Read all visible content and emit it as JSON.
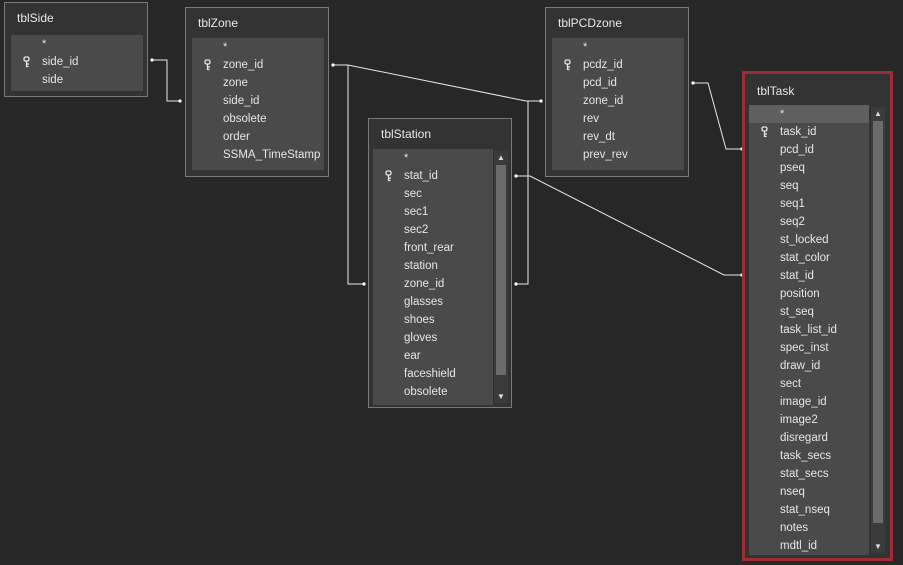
{
  "tables": {
    "tblSide": {
      "title": "tblSide",
      "fields": [
        "*",
        "side_id",
        "side"
      ]
    },
    "tblZone": {
      "title": "tblZone",
      "fields": [
        "*",
        "zone_id",
        "zone",
        "side_id",
        "obsolete",
        "order",
        "SSMA_TimeStamp"
      ]
    },
    "tblPCDzone": {
      "title": "tblPCDzone",
      "fields": [
        "*",
        "pcdz_id",
        "pcd_id",
        "zone_id",
        "rev",
        "rev_dt",
        "prev_rev"
      ]
    },
    "tblStation": {
      "title": "tblStation",
      "fields": [
        "*",
        "stat_id",
        "sec",
        "sec1",
        "sec2",
        "front_rear",
        "station",
        "zone_id",
        "glasses",
        "shoes",
        "gloves",
        "ear",
        "faceshield",
        "obsolete"
      ]
    },
    "tblTask": {
      "title": "tblTask",
      "fields": [
        "*",
        "task_id",
        "pcd_id",
        "pseq",
        "seq",
        "seq1",
        "seq2",
        "st_locked",
        "stat_color",
        "stat_id",
        "position",
        "st_seq",
        "task_list_id",
        "spec_inst",
        "draw_id",
        "sect",
        "image_id",
        "image2",
        "disregard",
        "task_secs",
        "stat_secs",
        "nseq",
        "stat_nseq",
        "notes",
        "mdtl_id"
      ]
    }
  },
  "colors": {
    "background": "#272727",
    "selected_border": "#9c2e33",
    "field_panel": "#4a4a4a",
    "relationship_line": "#e8e8e8"
  },
  "icons": {
    "primary_key": "key-icon",
    "scroll_up": "scroll-up-arrow-icon",
    "scroll_down": "scroll-down-arrow-icon"
  }
}
